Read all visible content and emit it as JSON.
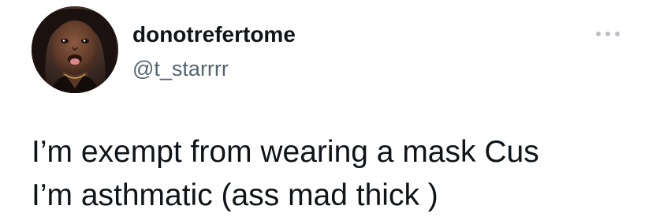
{
  "user": {
    "display_name": "donotrefertome",
    "handle": "@t_starrrr",
    "avatar": "profile-photo"
  },
  "menu": {
    "icon": "more-options-icon"
  },
  "tweet": {
    "lines": [
      "I’m exempt from wearing a mask Cus",
      "I’m asthmatic (ass mad thick )"
    ]
  },
  "colors": {
    "text_primary": "#0f1419",
    "text_secondary": "#536471",
    "icon_gray": "#b8bfc6",
    "background": "#ffffff"
  }
}
